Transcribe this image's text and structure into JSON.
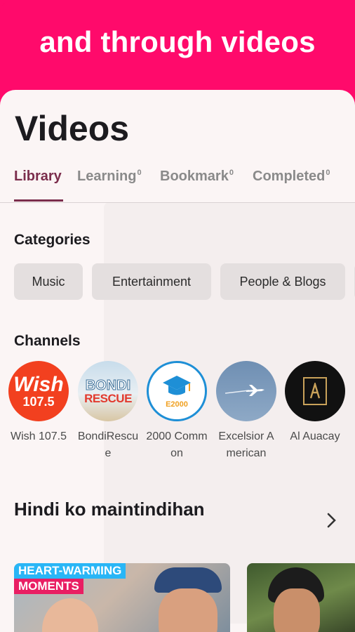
{
  "banner": {
    "text": "and through videos"
  },
  "page": {
    "title": "Videos"
  },
  "tabs": [
    {
      "label": "Library",
      "count": ""
    },
    {
      "label": "Learning",
      "count": "0"
    },
    {
      "label": "Bookmark",
      "count": "0"
    },
    {
      "label": "Completed",
      "count": "0"
    }
  ],
  "categories": {
    "title": "Categories",
    "items": [
      "Music",
      "Entertainment",
      "People & Blogs"
    ]
  },
  "channels": {
    "title": "Channels",
    "items": [
      {
        "name": "Wish 107.5",
        "logo_text": "Wish",
        "logo_subtext": "107.5",
        "color": "#f2401f"
      },
      {
        "name": "BondiRescue",
        "logo_text": "BONDI",
        "logo_subtext": "RESCUE",
        "color": "#dbe7ef"
      },
      {
        "name": "2000 Common",
        "logo_text": "E2000",
        "color": "#1e8fd6"
      },
      {
        "name": "Excelsior American",
        "color": "#7b98b8"
      },
      {
        "name": "Al Auacay",
        "color": "#1a1a1a"
      }
    ]
  },
  "playlist": {
    "title": "Hindi ko maintindihan",
    "thumbs": [
      {
        "caption_line1": "HEART-WARMING",
        "caption_line2": "MOMENTS"
      },
      {}
    ]
  }
}
